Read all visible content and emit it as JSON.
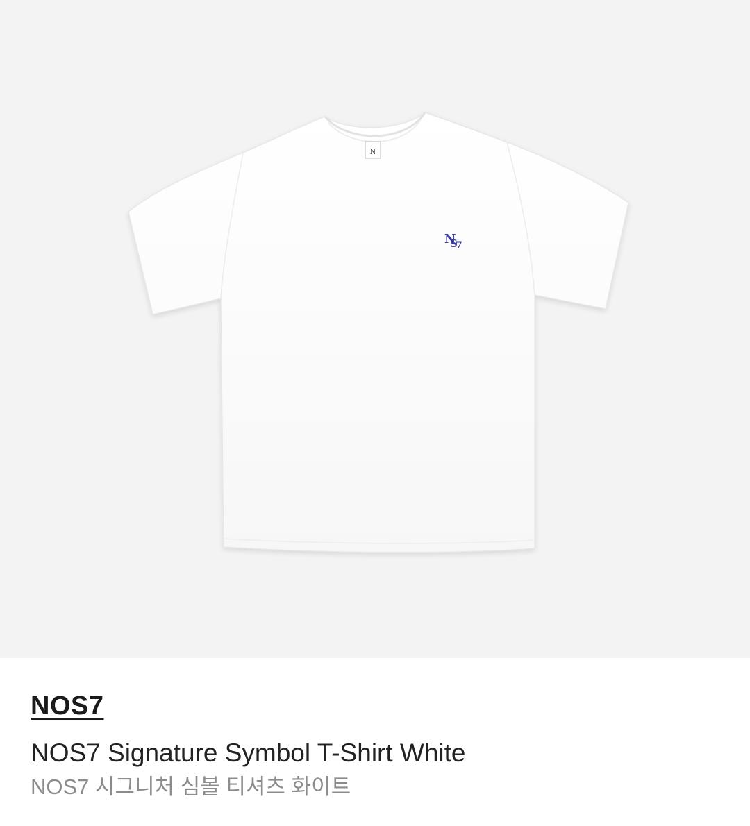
{
  "product": {
    "brand": "NOS7",
    "name_en": "NOS7 Signature Symbol T-Shirt White",
    "name_ko": "NOS7 시그니처 심볼 티셔츠 화이트"
  },
  "image": {
    "icon": "t-shirt-product-image",
    "background_color": "#f3f3f3",
    "shirt_color": "#ffffff",
    "logo_color": "#3b3aa0"
  }
}
